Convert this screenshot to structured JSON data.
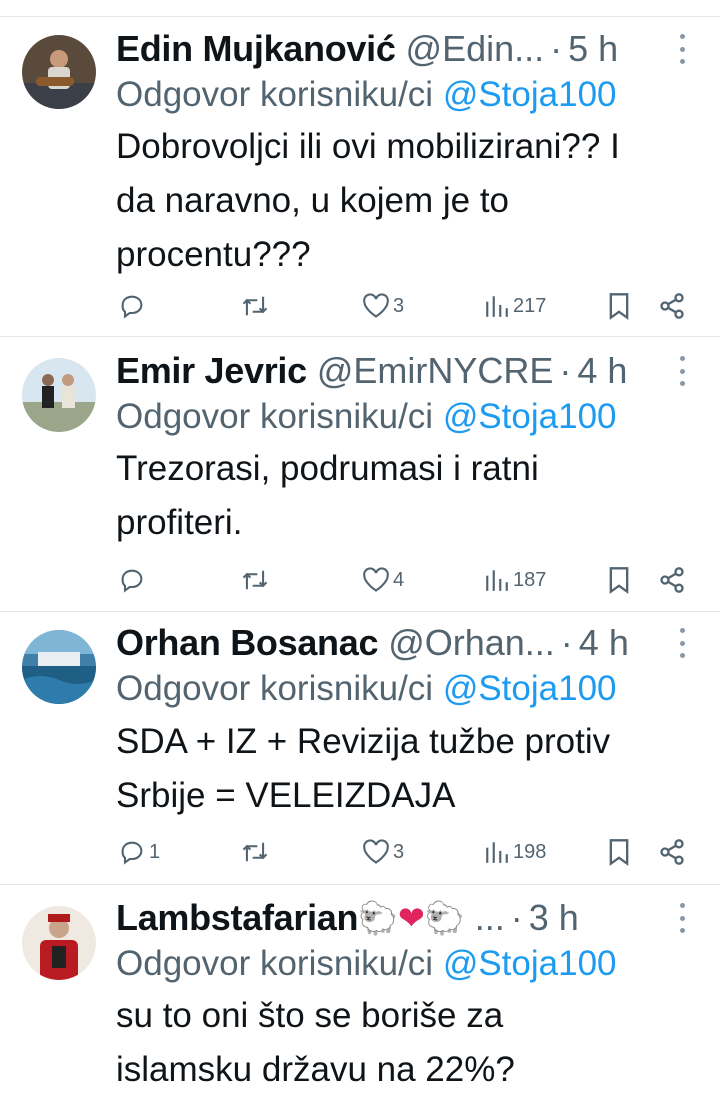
{
  "colors": {
    "text": "#0f1419",
    "secondary": "#536471",
    "link": "#1d9bf0",
    "divider": "#e6e9eb"
  },
  "reply_prefix": "Odgovor korisniku/ci",
  "tweets": [
    {
      "name": "Edin Mujkanović",
      "handle": "@Edin...",
      "separator": "·",
      "time": "5 h",
      "mention": "@Stoja100",
      "lines": [
        "Dobrovoljci ili ovi mobilizirani?? I",
        "da naravno, u kojem je to",
        "procentu???"
      ],
      "replies": "",
      "likes": "3",
      "views": "217"
    },
    {
      "name": "Emir Jevric",
      "handle": "@EmirNYCRE",
      "separator": "·",
      "time": "4 h",
      "mention": "@Stoja100",
      "lines": [
        "Trezorasi, podrumasi i ratni",
        "profiteri."
      ],
      "replies": "",
      "likes": "4",
      "views": "187"
    },
    {
      "name": "Orhan Bosanac",
      "handle": "@Orhan...",
      "separator": "·",
      "time": "4 h",
      "mention": "@Stoja100",
      "lines": [
        "SDA + IZ + Revizija tužbe protiv",
        "Srbije = VELEIZDAJA"
      ],
      "replies": "1",
      "likes": "3",
      "views": "198"
    },
    {
      "name": "Lambstafarian",
      "name_emoji": [
        "🐑",
        "❤",
        "🐑"
      ],
      "handle": "...",
      "separator": "·",
      "time": "3 h",
      "mention": "@Stoja100",
      "lines": [
        "su to oni što se boriše za",
        "islamsku državu na 22%?"
      ]
    }
  ],
  "icons": [
    "reply-icon",
    "retweet-icon",
    "like-icon",
    "views-icon",
    "bookmark-icon",
    "share-icon",
    "more-icon"
  ]
}
